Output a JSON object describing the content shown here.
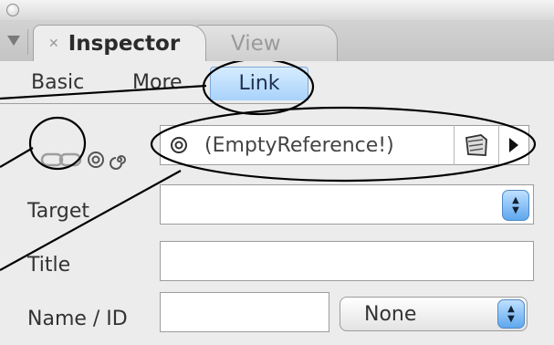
{
  "window": {
    "tabs": [
      {
        "label": "Inspector",
        "active": true
      },
      {
        "label": "View",
        "active": false
      }
    ]
  },
  "inspector": {
    "subtabs": [
      {
        "label": "Basic"
      },
      {
        "label": "More"
      },
      {
        "label": "Link",
        "selected": true
      }
    ],
    "link_icons": [
      "chain-icon",
      "at-icon",
      "spiral-icon"
    ],
    "reference_value": "(EmptyReference!)",
    "fields": {
      "target_label": "Target",
      "target_value": "",
      "title_label": "Title",
      "title_value": "",
      "name_label": "Name / ID",
      "name_value": "",
      "name_type_selected": "None"
    }
  },
  "stepper_glyphs": {
    "up": "▲",
    "down": "▼"
  },
  "colors": {
    "selected_tab": "#a8d2fb",
    "stepper": "#5ea7ee",
    "callout": "#000000"
  }
}
